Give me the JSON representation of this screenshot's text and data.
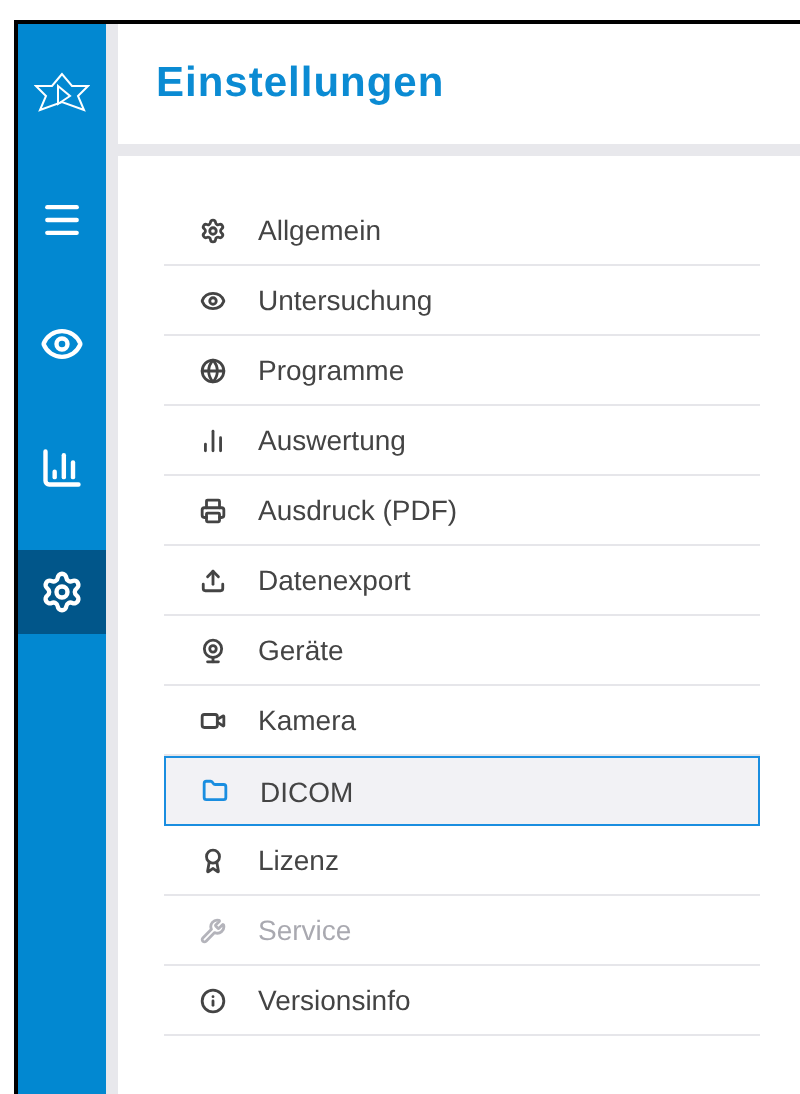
{
  "header": {
    "title": "Einstellungen"
  },
  "sidebar": {
    "items": [
      {
        "kind": "menu",
        "selected": false
      },
      {
        "kind": "eye",
        "selected": false
      },
      {
        "kind": "chart",
        "selected": false
      },
      {
        "kind": "gear",
        "selected": true
      }
    ]
  },
  "settings": [
    {
      "kind": "gear",
      "label": "Allgemein",
      "selected": false,
      "disabled": false
    },
    {
      "kind": "eye",
      "label": "Untersuchung",
      "selected": false,
      "disabled": false
    },
    {
      "kind": "globe",
      "label": "Programme",
      "selected": false,
      "disabled": false
    },
    {
      "kind": "chart",
      "label": "Auswertung",
      "selected": false,
      "disabled": false
    },
    {
      "kind": "printer",
      "label": "Ausdruck (PDF)",
      "selected": false,
      "disabled": false
    },
    {
      "kind": "upload",
      "label": "Datenexport",
      "selected": false,
      "disabled": false
    },
    {
      "kind": "webcam",
      "label": "Geräte",
      "selected": false,
      "disabled": false
    },
    {
      "kind": "camera",
      "label": "Kamera",
      "selected": false,
      "disabled": false
    },
    {
      "kind": "folder",
      "label": "DICOM",
      "selected": true,
      "disabled": false
    },
    {
      "kind": "award",
      "label": "Lizenz",
      "selected": false,
      "disabled": false
    },
    {
      "kind": "wrench",
      "label": "Service",
      "selected": false,
      "disabled": true
    },
    {
      "kind": "info",
      "label": "Versionsinfo",
      "selected": false,
      "disabled": false
    }
  ]
}
